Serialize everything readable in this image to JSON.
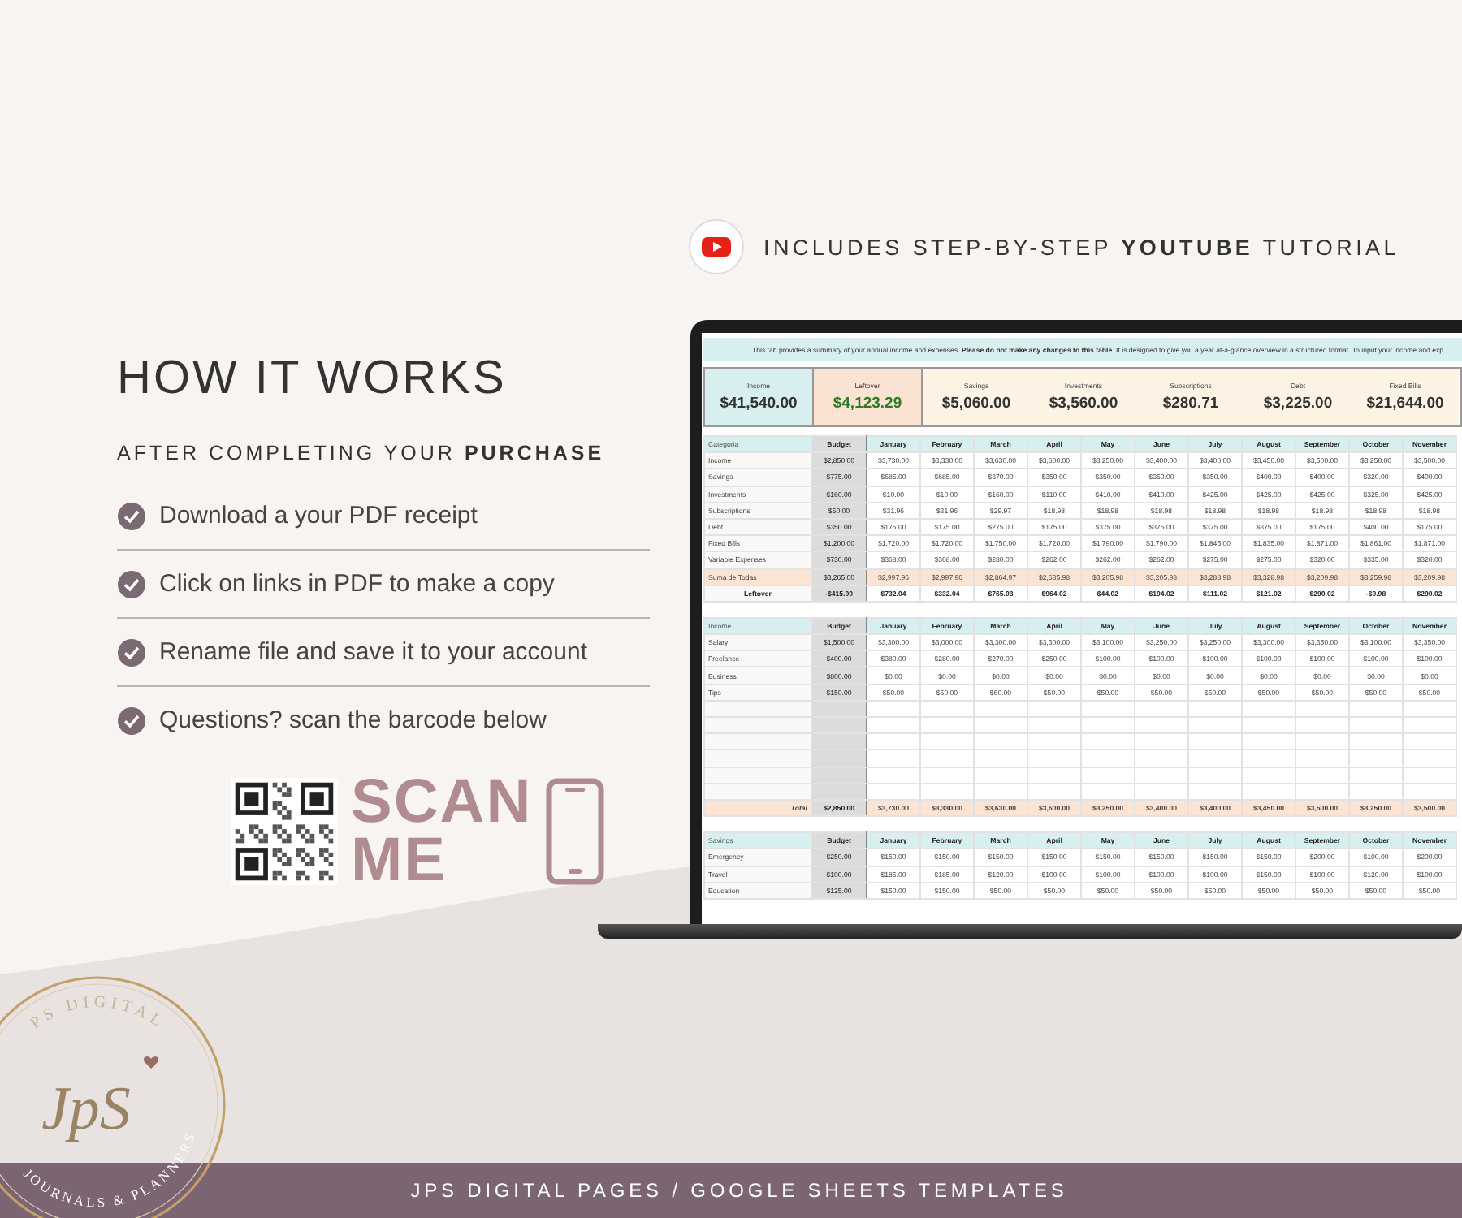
{
  "promo": {
    "tutorial_note": "INCLUDES STEP-BY-STEP **YOUTUBE** TUTORIAL",
    "title": "HOW IT WORKS",
    "subtitle": "AFTER COMPLETING YOUR **PURCHASE**",
    "steps": [
      "Download a your PDF receipt",
      "Click on links in PDF to make a copy",
      "Rename file and save it to your account",
      "Questions? scan the barcode below"
    ],
    "scan_label": [
      "SCAN",
      "ME"
    ]
  },
  "spreadsheet": {
    "notice": "This tab provides a summary of your annual income and expenses. **Please do not make any changes to this table**. It is designed to give you a year at-a-glance overview in a structured format. To input your income and exp",
    "summary": [
      {
        "kind": "income",
        "label": "Income",
        "value": "$41,540.00"
      },
      {
        "kind": "leftover",
        "label": "Leftover",
        "value": "$4,123.29"
      },
      {
        "kind": "expense",
        "label": "Savings",
        "value": "$5,060.00"
      },
      {
        "kind": "expense",
        "label": "Investments",
        "value": "$3,560.00"
      },
      {
        "kind": "expense",
        "label": "Subscriptions",
        "value": "$280.71"
      },
      {
        "kind": "expense",
        "label": "Debt",
        "value": "$3,225.00"
      },
      {
        "kind": "expense",
        "label": "Fixed Bills",
        "value": "$21,644.00"
      }
    ],
    "tables": [
      {
        "columns": [
          "Categoria",
          "Budget",
          "January",
          "February",
          "March",
          "April",
          "May",
          "June",
          "July",
          "August",
          "September",
          "October",
          "November"
        ],
        "rows": [
          {
            "kind": "item",
            "cells": [
              "Income",
              "$2,850.00",
              "$3,730.00",
              "$3,330.00",
              "$3,630.00",
              "$3,600.00",
              "$3,250.00",
              "$3,400.00",
              "$3,400.00",
              "$3,450.00",
              "$3,500.00",
              "$3,250.00",
              "$3,500.00"
            ]
          },
          {
            "kind": "item",
            "cells": [
              "Savings",
              "$775.00",
              "$685.00",
              "$685.00",
              "$370.00",
              "$350.00",
              "$350.00",
              "$350.00",
              "$350.00",
              "$400.00",
              "$400.00",
              "$320.00",
              "$400.00"
            ]
          },
          {
            "kind": "item",
            "cells": [
              "Investments",
              "$160.00",
              "$10.00",
              "$10.00",
              "$160.00",
              "$110.00",
              "$410.00",
              "$410.00",
              "$425.00",
              "$425.00",
              "$425.00",
              "$325.00",
              "$425.00"
            ]
          },
          {
            "kind": "item",
            "cells": [
              "Subscriptions",
              "$50.00",
              "$31.96",
              "$31.96",
              "$29.97",
              "$18.98",
              "$18.98",
              "$18.98",
              "$18.98",
              "$18.98",
              "$18.98",
              "$18.98",
              "$18.98"
            ]
          },
          {
            "kind": "item",
            "cells": [
              "Debt",
              "$350.00",
              "$175.00",
              "$175.00",
              "$275.00",
              "$175.00",
              "$375.00",
              "$375.00",
              "$375.00",
              "$375.00",
              "$175.00",
              "$400.00",
              "$175.00"
            ]
          },
          {
            "kind": "item",
            "cells": [
              "Fixed Bills",
              "$1,200.00",
              "$1,720.00",
              "$1,720.00",
              "$1,750.00",
              "$1,720.00",
              "$1,790.00",
              "$1,790.00",
              "$1,845.00",
              "$1,835.00",
              "$1,871.00",
              "$1,861.00",
              "$1,871.00"
            ]
          },
          {
            "kind": "item",
            "cells": [
              "Variable Expenses",
              "$730.00",
              "$368.00",
              "$368.00",
              "$280.00",
              "$262.00",
              "$262.00",
              "$262.00",
              "$275.00",
              "$275.00",
              "$320.00",
              "$335.00",
              "$320.00"
            ]
          },
          {
            "kind": "sum",
            "cells": [
              "Suma de Todas",
              "$3,265.00",
              "$2,997.96",
              "$2,997.96",
              "$2,864.97",
              "$2,635.98",
              "$3,205.98",
              "$3,205.98",
              "$3,288.98",
              "$3,328.98",
              "$3,209.98",
              "$3,259.98",
              "$3,209.98"
            ]
          },
          {
            "kind": "leftover",
            "cells": [
              "Leftover",
              "-$415.00",
              "$732.04",
              "$332.04",
              "$765.03",
              "$964.02",
              "$44.02",
              "$194.02",
              "$111.02",
              "$121.02",
              "$290.02",
              "-$9.98",
              "$290.02"
            ]
          }
        ]
      },
      {
        "columns": [
          "Income",
          "Budget",
          "January",
          "February",
          "March",
          "April",
          "May",
          "June",
          "July",
          "August",
          "September",
          "October",
          "November"
        ],
        "rows": [
          {
            "kind": "item",
            "cells": [
              "Salary",
              "$1,500.00",
              "$3,300.00",
              "$3,000.00",
              "$3,300.00",
              "$3,300.00",
              "$3,100.00",
              "$3,250.00",
              "$3,250.00",
              "$3,300.00",
              "$3,350.00",
              "$3,100.00",
              "$3,350.00"
            ]
          },
          {
            "kind": "item",
            "cells": [
              "Freelance",
              "$400.00",
              "$380.00",
              "$280.00",
              "$270.00",
              "$250.00",
              "$100.00",
              "$100.00",
              "$100.00",
              "$100.00",
              "$100.00",
              "$100.00",
              "$100.00"
            ]
          },
          {
            "kind": "item",
            "cells": [
              "Business",
              "$800.00",
              "$0.00",
              "$0.00",
              "$0.00",
              "$0.00",
              "$0.00",
              "$0.00",
              "$0.00",
              "$0.00",
              "$0.00",
              "$0.00",
              "$0.00"
            ]
          },
          {
            "kind": "item",
            "cells": [
              "Tips",
              "$150.00",
              "$50.00",
              "$50.00",
              "$60.00",
              "$50.00",
              "$50.00",
              "$50.00",
              "$50.00",
              "$50.00",
              "$50.00",
              "$50.00",
              "$50.00"
            ]
          },
          {
            "kind": "blank"
          },
          {
            "kind": "blank"
          },
          {
            "kind": "blank"
          },
          {
            "kind": "blank"
          },
          {
            "kind": "blank"
          },
          {
            "kind": "blank"
          },
          {
            "kind": "total",
            "cells": [
              "Total",
              "$2,850.00",
              "$3,730.00",
              "$3,330.00",
              "$3,630.00",
              "$3,600.00",
              "$3,250.00",
              "$3,400.00",
              "$3,400.00",
              "$3,450.00",
              "$3,500.00",
              "$3,250.00",
              "$3,500.00"
            ]
          }
        ]
      },
      {
        "columns": [
          "Savings",
          "Budget",
          "January",
          "February",
          "March",
          "April",
          "May",
          "June",
          "July",
          "August",
          "September",
          "October",
          "November"
        ],
        "rows": [
          {
            "kind": "item",
            "cells": [
              "Emergency",
              "$250.00",
              "$150.00",
              "$150.00",
              "$150.00",
              "$150.00",
              "$150.00",
              "$150.00",
              "$150.00",
              "$150.00",
              "$200.00",
              "$100.00",
              "$200.00"
            ]
          },
          {
            "kind": "item",
            "cells": [
              "Travel",
              "$100.00",
              "$185.00",
              "$185.00",
              "$120.00",
              "$100.00",
              "$100.00",
              "$100.00",
              "$100.00",
              "$150.00",
              "$100.00",
              "$120.00",
              "$100.00"
            ]
          },
          {
            "kind": "item",
            "cells": [
              "Education",
              "$125.00",
              "$150.00",
              "$150.00",
              "$50.00",
              "$50.00",
              "$50.00",
              "$50.00",
              "$50.00",
              "$50.00",
              "$50.00",
              "$50.00",
              "$50.00"
            ]
          }
        ]
      }
    ]
  },
  "logo": {
    "monogram": "JpS",
    "top_text": "PS DIGITAL",
    "bottom_text": "JOURNALS & PLANNERS"
  },
  "footer": {
    "text": "JPS DIGITAL PAGES / GOOGLE SHEETS TEMPLATES"
  }
}
